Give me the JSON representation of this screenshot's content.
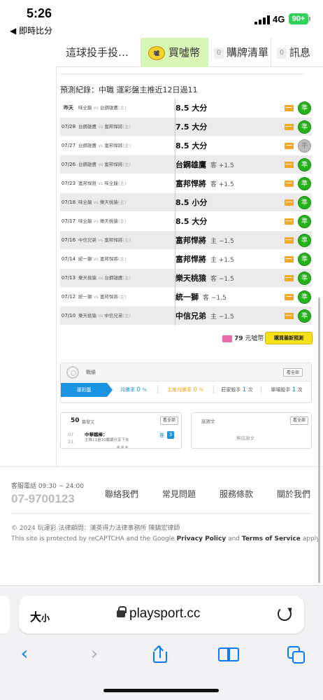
{
  "status": {
    "time": "5:26",
    "back_app": "◀ 即時比分",
    "network": "4G",
    "battery": "90+"
  },
  "tabs": [
    {
      "label": "這球投手投…",
      "count": ""
    },
    {
      "label": "買噓幣",
      "count": "",
      "icon": "coin-icon"
    },
    {
      "label": "購牌清單",
      "count": "0"
    },
    {
      "label": "訊息",
      "count": "0"
    }
  ],
  "records": {
    "title": "預測紀錄：中職 運彩盤主推近12日過11",
    "rows": [
      {
        "date": "昨天",
        "home": "味全龍",
        "away": "台鋼雄鷹",
        "suffix": "(主)",
        "pick": "8.5 大分",
        "odds": "",
        "result": "準"
      },
      {
        "date": "07/28",
        "home": "台鋼雄鷹",
        "away": "富邦悍將",
        "suffix": "(主)",
        "pick": "7.5 大分",
        "odds": "",
        "result": "準"
      },
      {
        "date": "07/27",
        "home": "台鋼雄鷹",
        "away": "富邦悍將",
        "suffix": "(主)",
        "pick": "8.5 大分",
        "odds": "",
        "result": "平"
      },
      {
        "date": "07/26",
        "home": "台鋼雄鷹",
        "away": "富邦悍將",
        "suffix": "(主)",
        "pick": "台鋼雄鷹",
        "odds": "客 +1.5",
        "result": "準"
      },
      {
        "date": "07/23",
        "home": "富邦悍將",
        "away": "味全龍",
        "suffix": "(主)",
        "pick": "富邦悍將",
        "odds": "客 +1.5",
        "result": "準"
      },
      {
        "date": "07/18",
        "home": "味全龍",
        "away": "樂天桃猿",
        "suffix": "(主)",
        "pick": "8.5 小分",
        "odds": "",
        "result": "準"
      },
      {
        "date": "07/17",
        "home": "味全龍",
        "away": "樂天桃猿",
        "suffix": "(主)",
        "pick": "8.5 大分",
        "odds": "",
        "result": "準"
      },
      {
        "date": "07/16",
        "home": "中信兄弟",
        "away": "富邦悍將",
        "suffix": "(主)",
        "pick": "富邦悍將",
        "odds": "主 −1.5",
        "result": "準"
      },
      {
        "date": "07/14",
        "home": "統一獅",
        "away": "富邦悍將",
        "suffix": "(主)",
        "pick": "富邦悍將",
        "odds": "主 +1.5",
        "result": "準"
      },
      {
        "date": "07/13",
        "home": "樂天桃猿",
        "away": "台鋼雄鷹",
        "suffix": "(主)",
        "pick": "樂天桃猿",
        "odds": "客 −1.5",
        "result": "準"
      },
      {
        "date": "07/12",
        "home": "統一獅",
        "away": "富邦悍將",
        "suffix": "(主)",
        "pick": "統一獅",
        "odds": "客 −1.5",
        "result": "準"
      },
      {
        "date": "07/10",
        "home": "樂天桃猿",
        "away": "中信兄弟",
        "suffix": "(主)",
        "pick": "中信兄弟",
        "odds": "主 −1.5",
        "result": "準"
      }
    ],
    "vs": "vs",
    "price": "79",
    "price_unit": "元噓幣",
    "buy_latest": "購買最新預測"
  },
  "stats": {
    "label": "戰績",
    "view_all": "看全部",
    "items": [
      {
        "label": "運彩盤",
        "value": ""
      },
      {
        "label": "月勝率",
        "value": "0",
        "unit": "%"
      },
      {
        "label": "主推月勝率",
        "value": "0",
        "unit": "%"
      },
      {
        "label": "莊家殺手",
        "value": "1",
        "unit": "次"
      },
      {
        "label": "單場殺手",
        "value": "1",
        "unit": "次"
      }
    ]
  },
  "posts": {
    "count": "50",
    "label": "篇發文",
    "view_all": "看全部",
    "date_month": "07",
    "date_day": "31",
    "title": "中華職棒：",
    "subtitle": "主推11過10繼續分享下去",
    "push_label": "推",
    "push_count": "3"
  },
  "replies": {
    "label": "底謝文",
    "view_all": "看全部",
    "empty": "無底謝文"
  },
  "footer": {
    "service_label": "客服電話 09:30 ~ 24:00",
    "service_number": "07-9700123",
    "links": [
      "聯絡我們",
      "常見問題",
      "服務條款",
      "關於我們"
    ],
    "copyright": "© 2024 玩運彩  法律顧問：漢英得力法律事務所 陳鎮宏律師",
    "recaptcha_prefix": "This site is protected by reCAPTCHA and the Google ",
    "privacy": "Privacy Policy",
    "and": " and ",
    "terms": "Terms of Service",
    "apply": " apply."
  },
  "browser": {
    "aa_big": "大",
    "aa_small": "小",
    "url": "playsport.cc"
  },
  "colors": {
    "win": "#26b21b",
    "accent": "#1a93e3",
    "coin_tab": "#d9f6b6",
    "buy_button": "#f7e11a"
  }
}
